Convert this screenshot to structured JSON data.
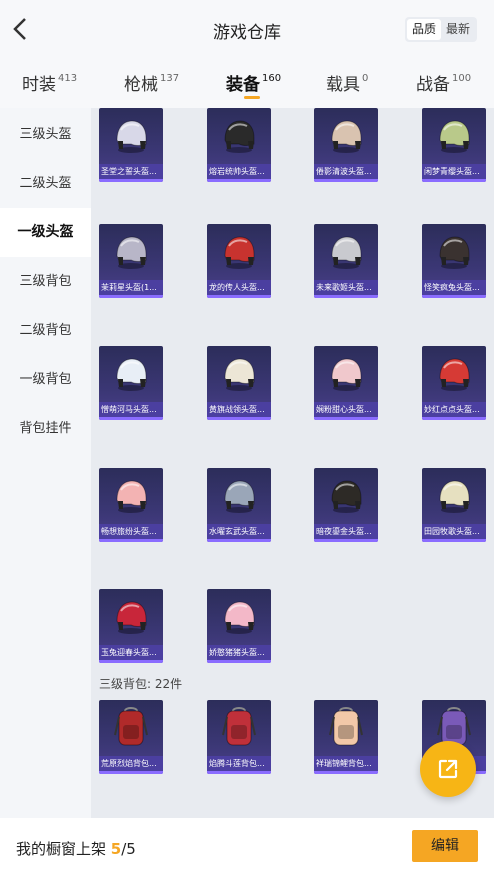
{
  "header": {
    "title": "游戏仓库",
    "sort_options": [
      "品质",
      "最新"
    ],
    "sort_selected": "品质"
  },
  "tabs": [
    {
      "label": "时装",
      "count": "413"
    },
    {
      "label": "枪械",
      "count": "137"
    },
    {
      "label": "装备",
      "count": "160"
    },
    {
      "label": "载具",
      "count": "0"
    },
    {
      "label": "战备",
      "count": "100"
    }
  ],
  "active_tab": "装备",
  "sidebar": {
    "items": [
      {
        "label": "三级头盔"
      },
      {
        "label": "二级头盔"
      },
      {
        "label": "一级头盔"
      },
      {
        "label": "三级背包"
      },
      {
        "label": "二级背包"
      },
      {
        "label": "一级背包"
      },
      {
        "label": "背包挂件"
      }
    ],
    "active": "一级头盔"
  },
  "items": [
    {
      "name": "圣堂之誓头盔...",
      "icon": "helmet-icon",
      "color": "#d8d8e8"
    },
    {
      "name": "熔岩统帅头盔...",
      "icon": "helmet-icon",
      "color": "#2a2a2a"
    },
    {
      "name": "倦影清波头盔...",
      "icon": "helmet-icon",
      "color": "#d9c3b0"
    },
    {
      "name": "闲梦青缨头盔...",
      "icon": "helmet-icon",
      "color": "#b9c98a"
    },
    {
      "name": "茉莉星头盔(1...",
      "icon": "helmet-icon",
      "color": "#b8b6c8"
    },
    {
      "name": "龙的传人头盔...",
      "icon": "helmet-icon",
      "color": "#c8332f"
    },
    {
      "name": "未来歌姬头盔...",
      "icon": "helmet-icon",
      "color": "#c9cacf"
    },
    {
      "name": "怪笑疯兔头盔...",
      "icon": "helmet-icon",
      "color": "#3a3230"
    },
    {
      "name": "憎萌河马头盔...",
      "icon": "helmet-icon",
      "color": "#e8eef6"
    },
    {
      "name": "黄旗战领头盔...",
      "icon": "helmet-icon",
      "color": "#ece6d6"
    },
    {
      "name": "娴粉甜心头盔...",
      "icon": "helmet-icon",
      "color": "#f0c8cc"
    },
    {
      "name": "妙红点点头盔...",
      "icon": "helmet-icon",
      "color": "#d63a35"
    },
    {
      "name": "畅想旅纷头盔...",
      "icon": "helmet-icon",
      "color": "#f3b3b3"
    },
    {
      "name": "水曜玄武头盔...",
      "icon": "helmet-icon",
      "color": "#9aa6b8"
    },
    {
      "name": "暗夜鎏金头盔...",
      "icon": "helmet-icon",
      "color": "#2d2a26"
    },
    {
      "name": "田园牧歌头盔...",
      "icon": "helmet-icon",
      "color": "#e6e0c0"
    },
    {
      "name": "玉兔迎春头盔...",
      "icon": "helmet-icon",
      "color": "#c8263a"
    },
    {
      "name": "娇憨猪猪头盔...",
      "icon": "helmet-icon",
      "color": "#f3b8c8"
    }
  ],
  "backpack_section": {
    "label": "三级背包: 22件"
  },
  "backpacks": [
    {
      "name": "荒原烈焰背包...",
      "icon": "backpack-icon",
      "color": "#b02a2a"
    },
    {
      "name": "焰腾斗莲背包...",
      "icon": "backpack-icon",
      "color": "#c0303a"
    },
    {
      "name": "祥瑞锦鲤背包...",
      "icon": "backpack-icon",
      "color": "#f2c8a8"
    },
    {
      "name": "",
      "icon": "backpack-icon",
      "color": "#7a5ab8"
    }
  ],
  "bottom": {
    "label": "我的橱窗上架",
    "current": "5",
    "total": "/5",
    "edit_label": "编辑"
  },
  "fab_icon": "share-external-icon"
}
